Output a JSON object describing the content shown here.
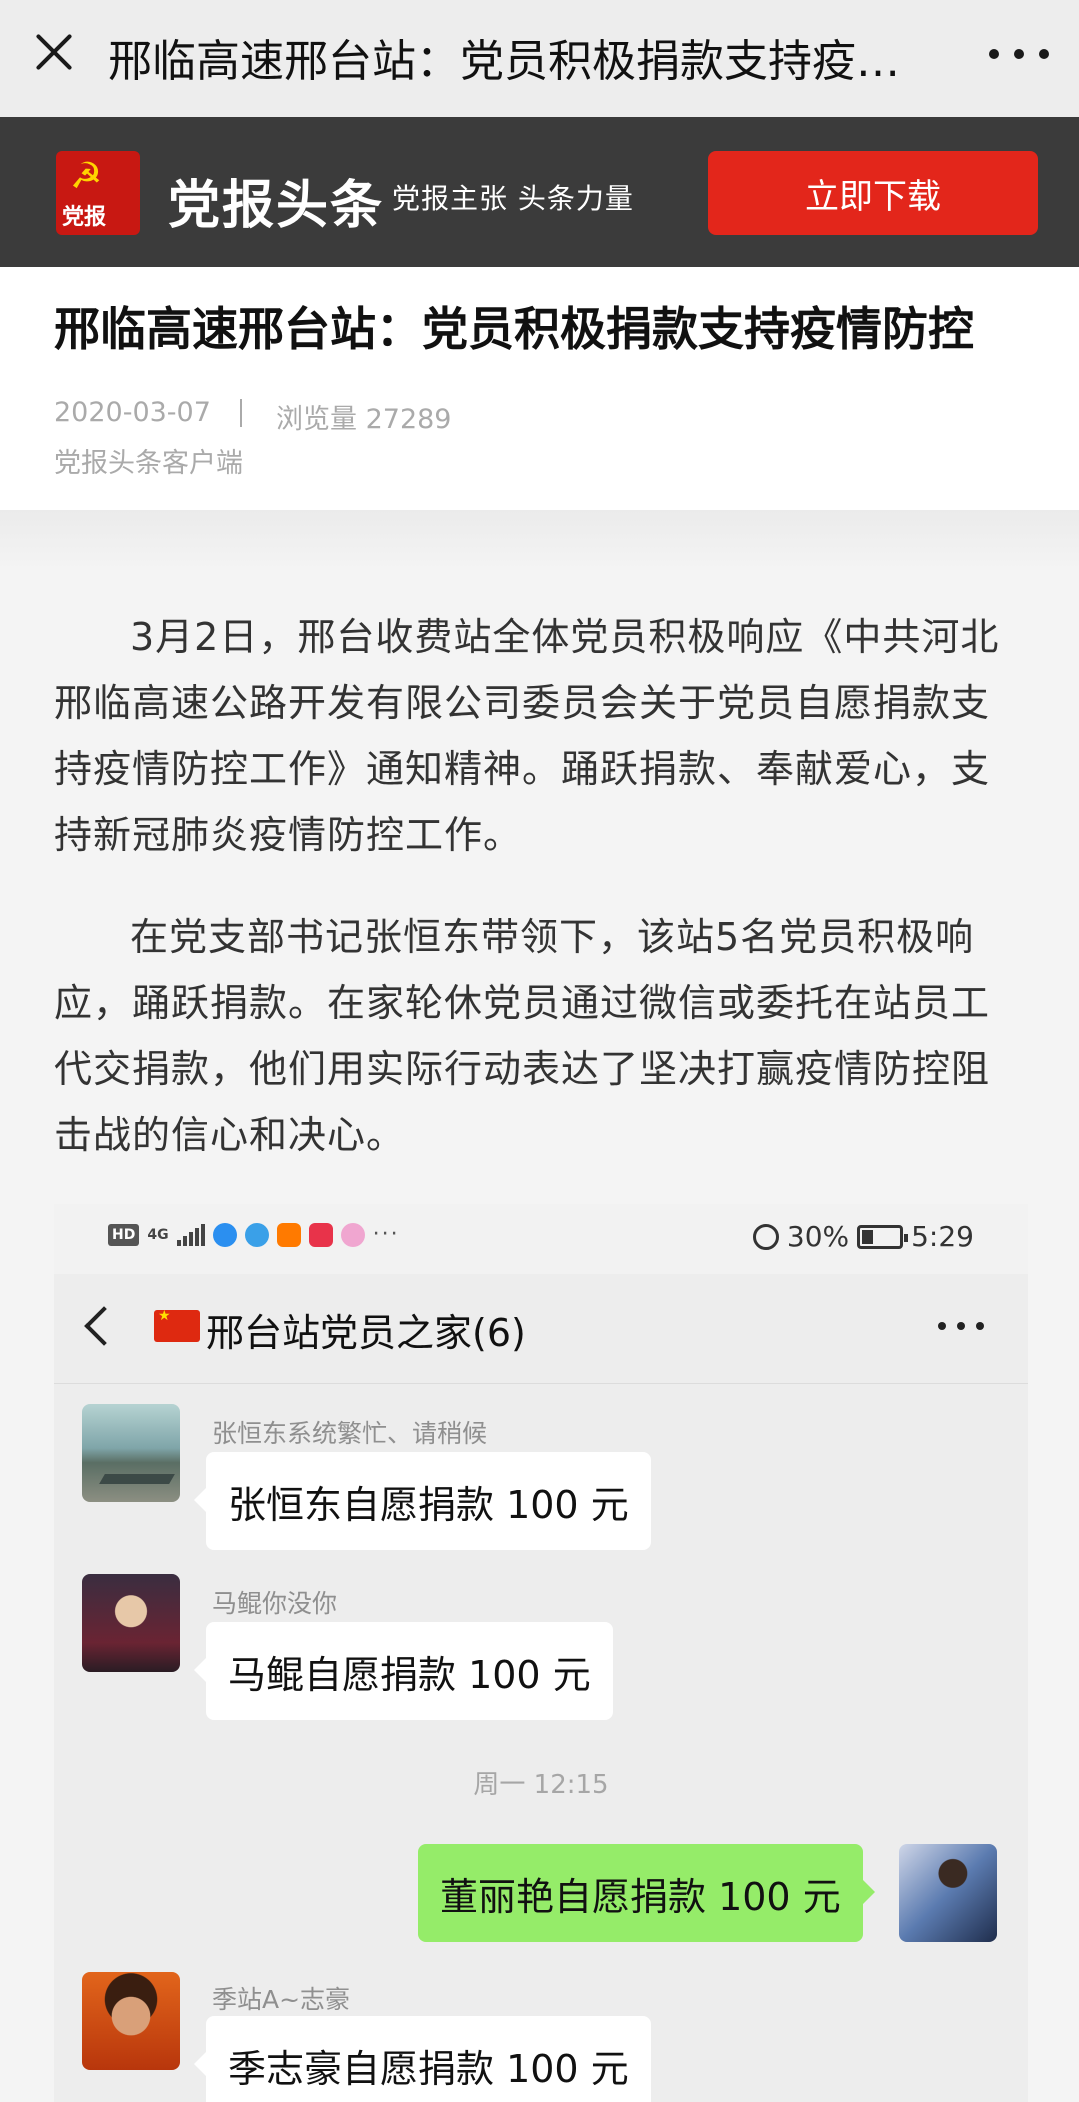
{
  "topbar": {
    "title": "邢临高速邢台站：党员积极捐款支持疫…"
  },
  "banner": {
    "logo_text": "党报",
    "app_name": "党报头条",
    "slogan": "党报主张 头条力量",
    "download_label": "立即下载"
  },
  "article": {
    "title": "邢临高速邢台站：党员积极捐款支持疫情防控",
    "date": "2020-03-07",
    "views": "浏览量 27289",
    "source": "党报头条客户端",
    "paragraphs": [
      "3月2日，邢台收费站全体党员积极响应《中共河北邢临高速公路开发有限公司委员会关于党员自愿捐款支持疫情防控工作》通知精神。踊跃捐款、奉献爱心，支持新冠肺炎疫情防控工作。",
      "在党支部书记张恒东带领下，该站5名党员积极响应，踊跃捐款。在家轮休党员通过微信或委托在站员工代交捐款，他们用实际行动表达了坚决打赢疫情防控阻击战的信心和决心。"
    ]
  },
  "screenshot": {
    "status_bar": {
      "hd": "HD",
      "network": "4G",
      "battery": "30%",
      "time": "5:29"
    },
    "chat_title": "邢台站党员之家(6)",
    "timestamp": "周一 12:15",
    "messages": [
      {
        "sender": "张恒东系统繁忙、请稍候",
        "text": "张恒东自愿捐款 100 元",
        "direction": "in"
      },
      {
        "sender": "马鲲你没你",
        "text": "马鲲自愿捐款 100 元",
        "direction": "in"
      },
      {
        "sender": "",
        "text": "董丽艳自愿捐款 100 元",
        "direction": "out"
      },
      {
        "sender": "季站A~志豪",
        "text": "季志豪自愿捐款 100 元",
        "direction": "in"
      }
    ]
  },
  "colors": {
    "banner_bg": "#3b3b3b",
    "download_button": "#e3261b",
    "logo_red": "#c81812",
    "outgoing_bubble": "#95ec69"
  },
  "icons": [
    "close-icon",
    "more-icon",
    "party-logo-icon",
    "back-icon",
    "flag-icon",
    "alarm-icon",
    "battery-icon",
    "signal-icon"
  ]
}
